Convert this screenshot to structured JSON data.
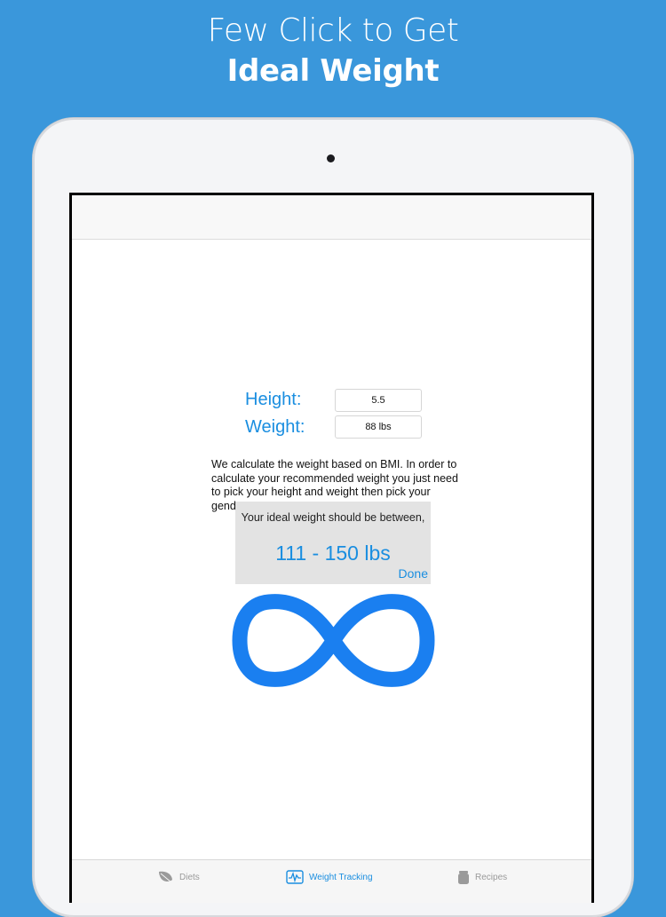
{
  "promo": {
    "line1": "Few Click to Get",
    "line2": "Ideal Weight"
  },
  "form": {
    "height_label": "Height:",
    "height_value": "5.5",
    "weight_label": "Weight:",
    "weight_value": "88 lbs"
  },
  "description": "We calculate the weight based on BMI. In order to calculate your recommended weight you just need to pick your height and weight then pick your gender.",
  "result": {
    "message": "Your ideal weight should be between,",
    "range": "111 - 150 lbs",
    "done_label": "Done"
  },
  "tabs": [
    {
      "label": "Diets",
      "icon": "leaf-icon",
      "active": false
    },
    {
      "label": "Weight Tracking",
      "icon": "pulse-icon",
      "active": true
    },
    {
      "label": "Recipes",
      "icon": "jar-icon",
      "active": false
    }
  ],
  "colors": {
    "background": "#3a97db",
    "accent": "#1a8ee0",
    "spinner": "#1a7ff0"
  }
}
